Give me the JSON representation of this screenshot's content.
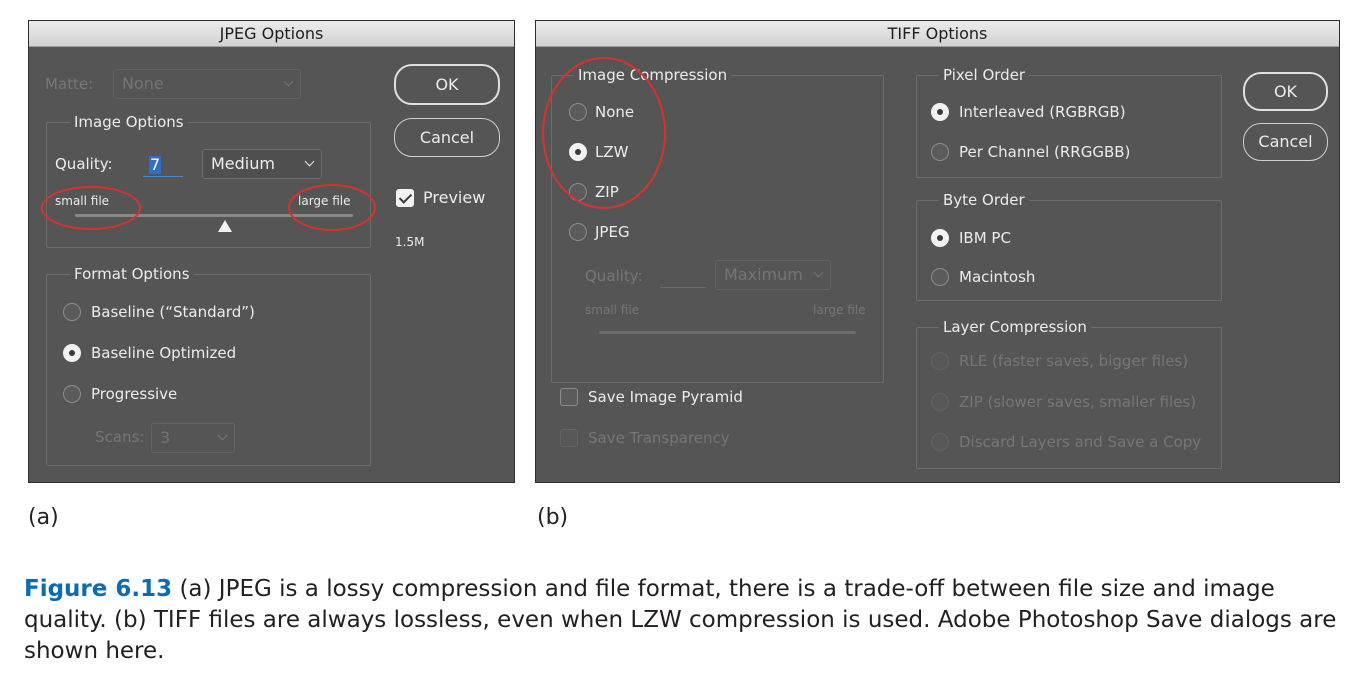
{
  "jpeg": {
    "title": "JPEG Options",
    "matte_label": "Matte:",
    "matte_value": "None",
    "ok": "OK",
    "cancel": "Cancel",
    "preview": "Preview",
    "preview_checked": true,
    "file_size": "1.5M",
    "image_options": {
      "label": "Image Options",
      "quality_label": "Quality:",
      "quality_value": "7",
      "quality_preset": "Medium",
      "small_file": "small file",
      "large_file": "large file",
      "slider_level": 0.54
    },
    "format_options": {
      "label": "Format Options",
      "options": [
        "Baseline (“Standard”)",
        "Baseline Optimized",
        "Progressive"
      ],
      "selected": "Baseline Optimized",
      "scans_label": "Scans:",
      "scans_value": "3"
    }
  },
  "tiff": {
    "title": "TIFF Options",
    "ok": "OK",
    "cancel": "Cancel",
    "image_compression": {
      "label": "Image Compression",
      "options": [
        "None",
        "LZW",
        "ZIP",
        "JPEG"
      ],
      "selected": "LZW",
      "quality_label": "Quality:",
      "quality_preset": "Maximum",
      "small_file": "small file",
      "large_file": "large file"
    },
    "save_image_pyramid": "Save Image Pyramid",
    "save_transparency": "Save Transparency",
    "pixel_order": {
      "label": "Pixel Order",
      "options": [
        "Interleaved (RGBRGB)",
        "Per Channel (RRGGBB)"
      ],
      "selected": "Interleaved (RGBRGB)"
    },
    "byte_order": {
      "label": "Byte Order",
      "options": [
        "IBM PC",
        "Macintosh"
      ],
      "selected": "IBM PC"
    },
    "layer_compression": {
      "label": "Layer Compression",
      "options": [
        "RLE (faster saves, bigger files)",
        "ZIP (slower saves, smaller files)",
        "Discard Layers and Save a Copy"
      ]
    }
  },
  "labels": {
    "a": "(a)",
    "b": "(b)"
  },
  "caption": {
    "figure": "Figure 6.13",
    "text": "(a) JPEG is a lossy compression and file format, there is a trade-off between file size and image quality. (b) TIFF files are always lossless, even when LZW compression is used. Adobe Photoshop Save dialogs are shown here."
  },
  "colors": {
    "dialog_bg": "#555556",
    "highlight_ring": "#d8332a",
    "figure_label": "#0c6cb1"
  }
}
